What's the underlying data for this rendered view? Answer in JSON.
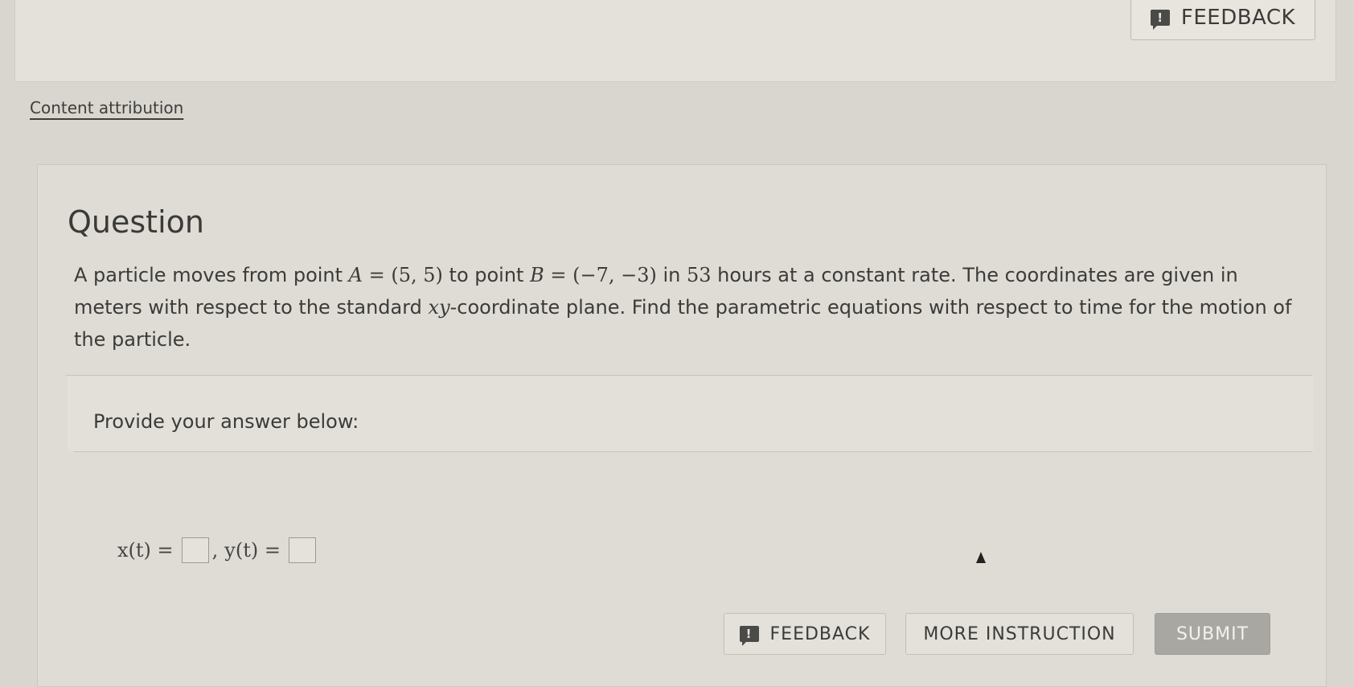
{
  "header": {
    "feedback_label": "FEEDBACK",
    "feedback_icon": "!"
  },
  "attribution": {
    "label": "Content attribution"
  },
  "question": {
    "title": "Question",
    "text_parts": {
      "p1": "A particle moves from point ",
      "pointA_label": "A",
      "pointA_value": " = (5,  5)",
      "p2": " to point ",
      "pointB_label": "B",
      "pointB_value": " = (−7,  −3)",
      "p3": " in ",
      "hours": "53",
      "p4": " hours at a constant rate. The coordinates are given in meters with respect to the standard ",
      "xy": "xy",
      "p5": "-coordinate plane. Find the parametric equations with respect to time for the motion of the particle."
    }
  },
  "answer": {
    "prompt": "Provide your answer below:",
    "x_label": "x(t) =",
    "separator": ",",
    "y_label": "y(t) ="
  },
  "buttons": {
    "feedback": "FEEDBACK",
    "feedback_icon": "!",
    "more_instruction": "MORE INSTRUCTION",
    "submit": "SUBMIT"
  }
}
